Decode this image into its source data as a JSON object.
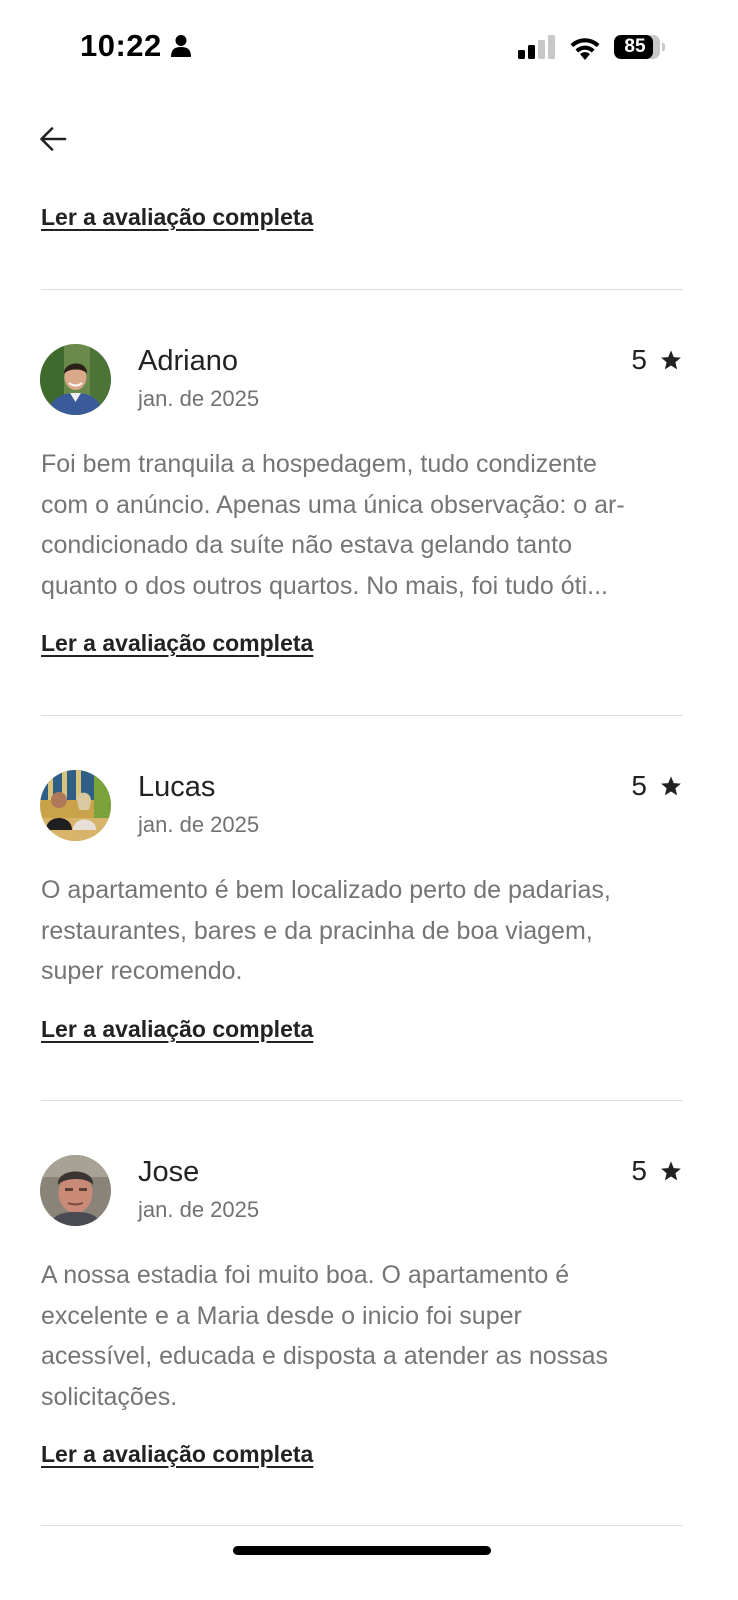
{
  "status_bar": {
    "time": "10:22",
    "battery_level": "85",
    "battery_fraction": 0.85,
    "icons": [
      "person-icon",
      "signal-icon",
      "wifi-icon",
      "battery-icon"
    ]
  },
  "header": {
    "back_icon": "arrow-left-icon"
  },
  "top_link": "Ler a avaliação completa",
  "reviews": [
    {
      "name": "Adriano",
      "date": "jan. de 2025",
      "rating": "5",
      "text": "Foi bem tranquila a hospedagem, tudo condizente\ncom o anúncio. Apenas uma única observação: o ar-\ncondicionado da suíte não estava gelando tanto\nquanto o dos outros quartos. No mais, foi tudo óti...",
      "link": "Ler a avaliação completa"
    },
    {
      "name": "Lucas",
      "date": "jan. de 2025",
      "rating": "5",
      "text": "O apartamento é bem localizado perto de padarias,\nrestaurantes, bares e da pracinha de boa viagem,\nsuper recomendo.",
      "link": "Ler a avaliação completa"
    },
    {
      "name": "Jose",
      "date": "jan. de 2025",
      "rating": "5",
      "text": "A nossa estadia foi muito boa. O apartamento é\nexcelente e a Maria desde o inicio foi super\nacessível, educada e disposta a atender as nossas\nsolicitações.",
      "link": "Ler a avaliação completa"
    }
  ],
  "colors": {
    "text_primary": "#222222",
    "text_secondary": "#717171",
    "divider": "#dddddd",
    "background": "#ffffff"
  }
}
